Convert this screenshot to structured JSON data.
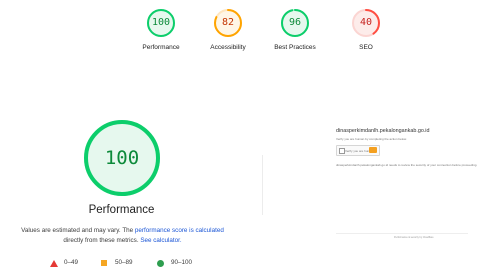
{
  "summary": [
    {
      "key": "perf",
      "label": "Performance",
      "score": "100",
      "value": 1.0,
      "color": "#0cce6b"
    },
    {
      "key": "acc",
      "label": "Accessibility",
      "score": "82",
      "value": 0.82,
      "color": "#ffa400"
    },
    {
      "key": "bp",
      "label": "Best Practices",
      "score": "96",
      "value": 0.96,
      "color": "#0cce6b"
    },
    {
      "key": "seo",
      "label": "SEO",
      "score": "40",
      "value": 0.4,
      "color": "#ff4e42"
    }
  ],
  "main": {
    "score": "100",
    "value": 1.0,
    "title": "Performance",
    "note_prefix": "Values are estimated and may vary. The ",
    "note_link1": "performance score is calculated",
    "note_middle": " directly from these metrics. ",
    "note_link2": "See calculator."
  },
  "legend": [
    {
      "range": "0–49",
      "color": "#e53935",
      "shape": "triangle"
    },
    {
      "range": "50–89",
      "color": "#f5a623",
      "shape": "square"
    },
    {
      "range": "90–100",
      "color": "#2e9e4f",
      "shape": "circle"
    }
  ],
  "screenshot": {
    "host": "dinasperkimdanlh.pekalongankab.go.id",
    "verify": "Verify you are human by completing the action below.",
    "captcha_label": "Verify you are human",
    "description": "dinasperkimdanlh.pekalongankab.go.id needs to review the security of your connection before proceeding.",
    "footer": "Performance & security by Cloudflare"
  }
}
